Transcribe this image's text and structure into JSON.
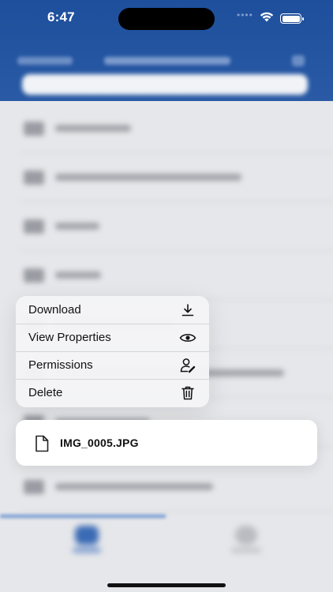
{
  "status_bar": {
    "time": "6:47",
    "signal": "••••"
  },
  "context_menu": {
    "items": [
      {
        "label": "Download",
        "icon": "download-icon"
      },
      {
        "label": "View Properties",
        "icon": "eye-icon"
      },
      {
        "label": "Permissions",
        "icon": "user-permissions-icon"
      },
      {
        "label": "Delete",
        "icon": "trash-icon"
      }
    ]
  },
  "selected_file": {
    "name": "IMG_0005.JPG",
    "icon": "document-icon"
  },
  "colors": {
    "header_blue": "#1d4f9c",
    "accent": "#2a5aa5"
  }
}
